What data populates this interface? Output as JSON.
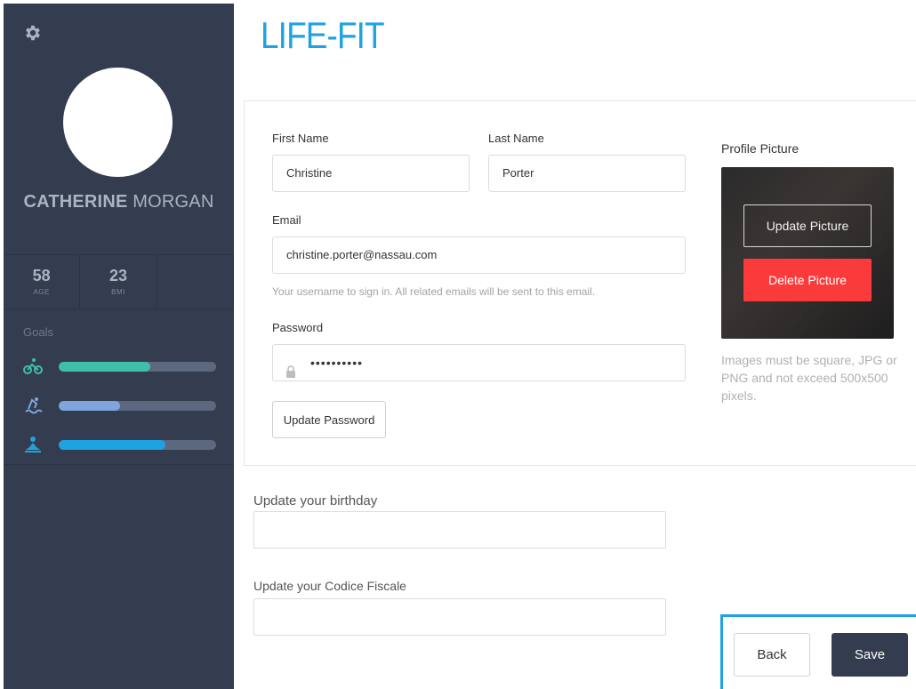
{
  "brand": {
    "title": "LIFE-FIT"
  },
  "sidebar": {
    "user": {
      "first_name": "CATHERINE",
      "last_name": "MORGAN"
    },
    "stats": [
      {
        "value": "58",
        "label": "AGE"
      },
      {
        "value": "23",
        "label": "BMI"
      }
    ],
    "goals_title": "Goals",
    "goals": [
      {
        "icon": "cycling-icon",
        "progress": 0.58,
        "color": "#3fbfa8"
      },
      {
        "icon": "swimming-icon",
        "progress": 0.39,
        "color": "#7ea5de"
      },
      {
        "icon": "meditation-icon",
        "progress": 0.68,
        "color": "#1fa3e0"
      }
    ]
  },
  "form": {
    "first_name_label": "First Name",
    "first_name_value": "Christine",
    "last_name_label": "Last Name",
    "last_name_value": "Porter",
    "email_label": "Email",
    "email_value": "christine.porter@nassau.com",
    "email_hint": "Your username to sign in. All related emails will be sent to this email.",
    "password_label": "Password",
    "password_value": "••••••••••",
    "update_password_label": "Update Password"
  },
  "profile_picture": {
    "title": "Profile Picture",
    "update_label": "Update Picture",
    "delete_label": "Delete Picture",
    "hint": "Images must be square, JPG or PNG and not exceed 500x500 pixels."
  },
  "birthday": {
    "label": "Update your birthday"
  },
  "codice_fiscale": {
    "label": "Update your Codice Fiscale"
  },
  "actions": {
    "back_label": "Back",
    "save_label": "Save"
  },
  "colors": {
    "sidebar": "#333d4f",
    "accent": "#1fa3e0",
    "danger": "#fb3b3b"
  }
}
